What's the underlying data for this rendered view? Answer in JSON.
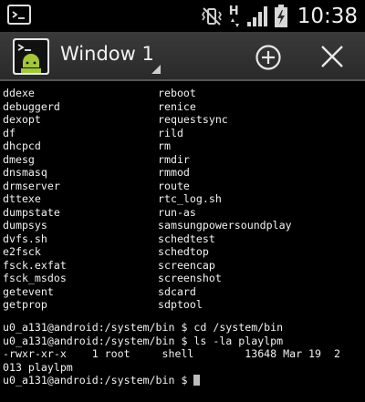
{
  "status_bar": {
    "time": "10:38",
    "network_type": "H",
    "icons": [
      "screenshot-icon",
      "vibrate-mute-icon",
      "hspa-network-icon",
      "signal-icon",
      "battery-charging-icon"
    ]
  },
  "action_bar": {
    "app_icon": "android-terminal-icon",
    "title": "Window 1",
    "new_window_icon": "add-circle-icon",
    "close_icon": "close-icon"
  },
  "terminal": {
    "listing": [
      [
        "ddexe",
        "reboot"
      ],
      [
        "debuggerd",
        "renice"
      ],
      [
        "dexopt",
        "requestsync"
      ],
      [
        "df",
        "rild"
      ],
      [
        "dhcpcd",
        "rm"
      ],
      [
        "dmesg",
        "rmdir"
      ],
      [
        "dnsmasq",
        "rmmod"
      ],
      [
        "drmserver",
        "route"
      ],
      [
        "dttexe",
        "rtc_log.sh"
      ],
      [
        "dumpstate",
        "run-as"
      ],
      [
        "dumpsys",
        "samsungpowersoundplay"
      ],
      [
        "dvfs.sh",
        "schedtest"
      ],
      [
        "e2fsck",
        "schedtop"
      ],
      [
        "fsck.exfat",
        "screencap"
      ],
      [
        "fsck_msdos",
        "screenshot"
      ],
      [
        "getevent",
        "sdcard"
      ],
      [
        "getprop",
        "sdptool"
      ]
    ],
    "session": [
      "u0_a131@android:/system/bin $ cd /system/bin",
      "u0_a131@android:/system/bin $ ls -la playlpm",
      "-rwxr-xr-x    1 root     shell        13648 Mar 19  2",
      "013 playlpm"
    ],
    "prompt": "u0_a131@android:/system/bin $ "
  },
  "colors": {
    "background": "#000000",
    "text": "#f2f2f2",
    "action_bar": "#2f2f2f",
    "cursor": "#bdbdbd"
  }
}
